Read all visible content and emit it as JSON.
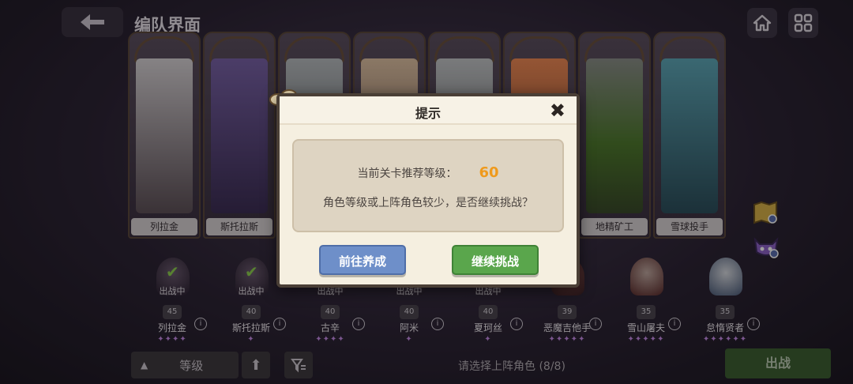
{
  "header": {
    "title": "编队界面"
  },
  "cards": [
    {
      "name": "列拉金",
      "color": "#8d7f8f"
    },
    {
      "name": "斯托拉斯",
      "color": "#6b5390"
    },
    {
      "name": "",
      "color": "#9aa0a6"
    },
    {
      "name": "",
      "color": "#c9a080"
    },
    {
      "name": "",
      "color": "#a0a3a5"
    },
    {
      "name": "",
      "color": "#d07a4b"
    },
    {
      "name": "地精矿工",
      "color": "#5f7d4a"
    },
    {
      "name": "雪球投手",
      "color": "#4a7c8a"
    }
  ],
  "team": [
    {
      "name": "列拉金",
      "status": "出战中",
      "level": "45",
      "stars": "✦✦✦✦",
      "selected": true
    },
    {
      "name": "斯托拉斯",
      "status": "出战中",
      "level": "40",
      "stars": "✦",
      "selected": true
    },
    {
      "name": "古辛",
      "status": "出战中",
      "level": "40",
      "stars": "✦✦✦✦",
      "selected": true
    },
    {
      "name": "阿米",
      "status": "出战中",
      "level": "40",
      "stars": "✦",
      "selected": true
    },
    {
      "name": "夏珂丝",
      "status": "出战中",
      "level": "40",
      "stars": "✦",
      "selected": true
    },
    {
      "name": "恶魔吉他手",
      "status": "",
      "level": "39",
      "stars": "✦✦✦✦✦",
      "selected": false
    },
    {
      "name": "雪山屠夫",
      "status": "",
      "level": "35",
      "stars": "✦✦✦✦✦",
      "selected": false
    },
    {
      "name": "怠惰贤者",
      "status": "",
      "level": "35",
      "stars": "✦✦✦✦✦✦",
      "selected": false
    }
  ],
  "bottom": {
    "sort_label": "等级",
    "hint": "请选择上阵角色 (8/8)",
    "go_label": "出战"
  },
  "dialog": {
    "title": "提示",
    "recommend_label": "当前关卡推荐等级：",
    "recommend_level": "60",
    "message": "角色等级或上阵角色较少，是否继续挑战？",
    "train_label": "前往养成",
    "continue_label": "继续挑战"
  }
}
